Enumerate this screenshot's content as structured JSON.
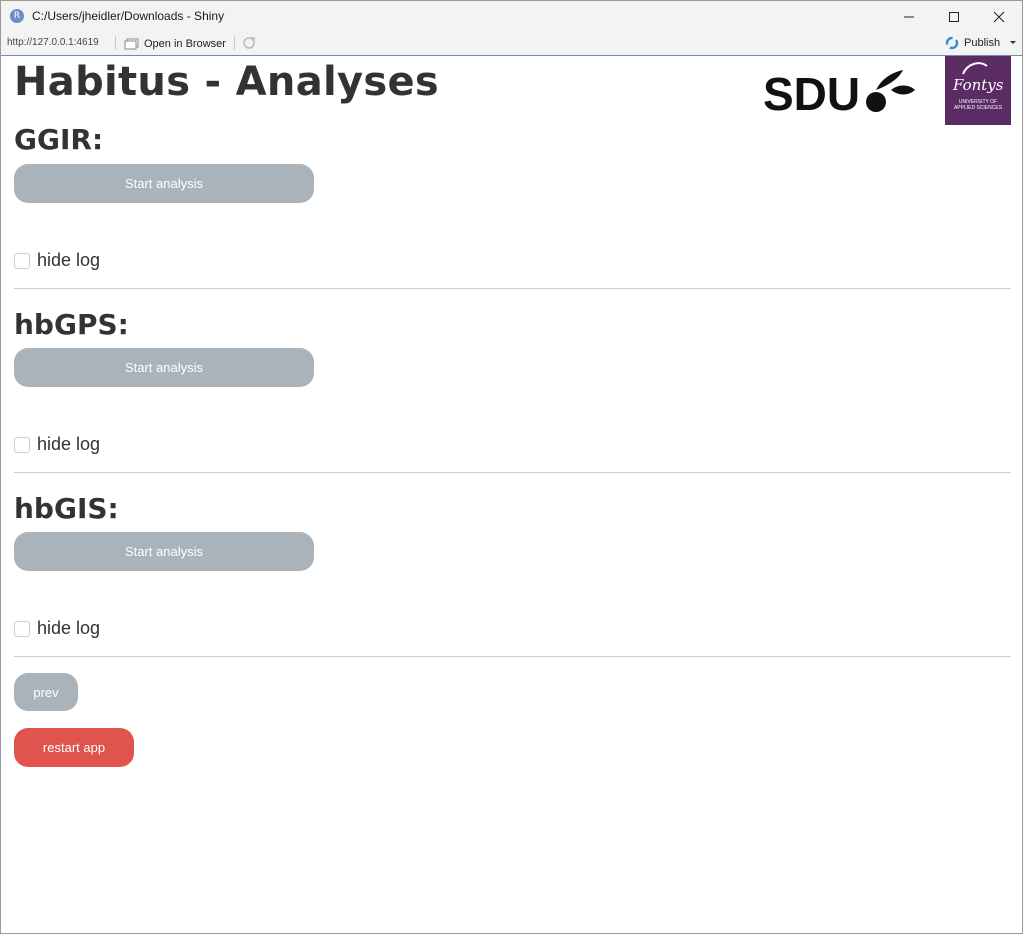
{
  "window": {
    "title": "C:/Users/jheidler/Downloads - Shiny",
    "app_icon_letter": "R"
  },
  "toolbar": {
    "url": "http://127.0.0.1:4619",
    "open_in_browser": "Open in Browser",
    "publish": "Publish"
  },
  "page": {
    "title": "Habitus - Analyses",
    "logos": {
      "sdu": "SDU",
      "fontys_name": "Fontys",
      "fontys_sub": "UNIVERSITY OF APPLIED SCIENCES"
    }
  },
  "sections": [
    {
      "heading": "GGIR:",
      "button": "Start analysis",
      "checkbox": "hide log"
    },
    {
      "heading": "hbGPS:",
      "button": "Start analysis",
      "checkbox": "hide log"
    },
    {
      "heading": "hbGIS:",
      "button": "Start analysis",
      "checkbox": "hide log"
    }
  ],
  "footer": {
    "prev": "prev",
    "restart": "restart app"
  },
  "colors": {
    "grey_button": "#aab3b9",
    "red_button": "#e0544d",
    "fontys_purple": "#5b2b63"
  }
}
